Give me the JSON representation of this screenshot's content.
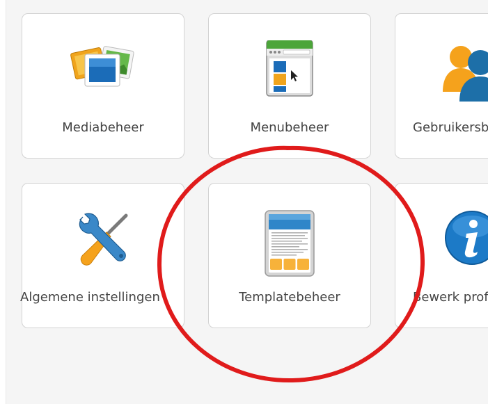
{
  "tiles": [
    {
      "label": "Mediabeheer",
      "icon": "media-icon"
    },
    {
      "label": "Menubeheer",
      "icon": "menu-icon"
    },
    {
      "label": "Gebruikersbeheer",
      "icon": "users-icon"
    },
    {
      "label": "Algemene instellingen",
      "icon": "config-icon"
    },
    {
      "label": "Templatebeheer",
      "icon": "template-icon"
    },
    {
      "label": "Bewerk profiel",
      "icon": "info-icon"
    }
  ],
  "colors": {
    "highlight_circle": "#e01b1b",
    "tile_border": "#d3d3d3",
    "panel_background": "#f5f5f5",
    "label_text": "#444444"
  }
}
